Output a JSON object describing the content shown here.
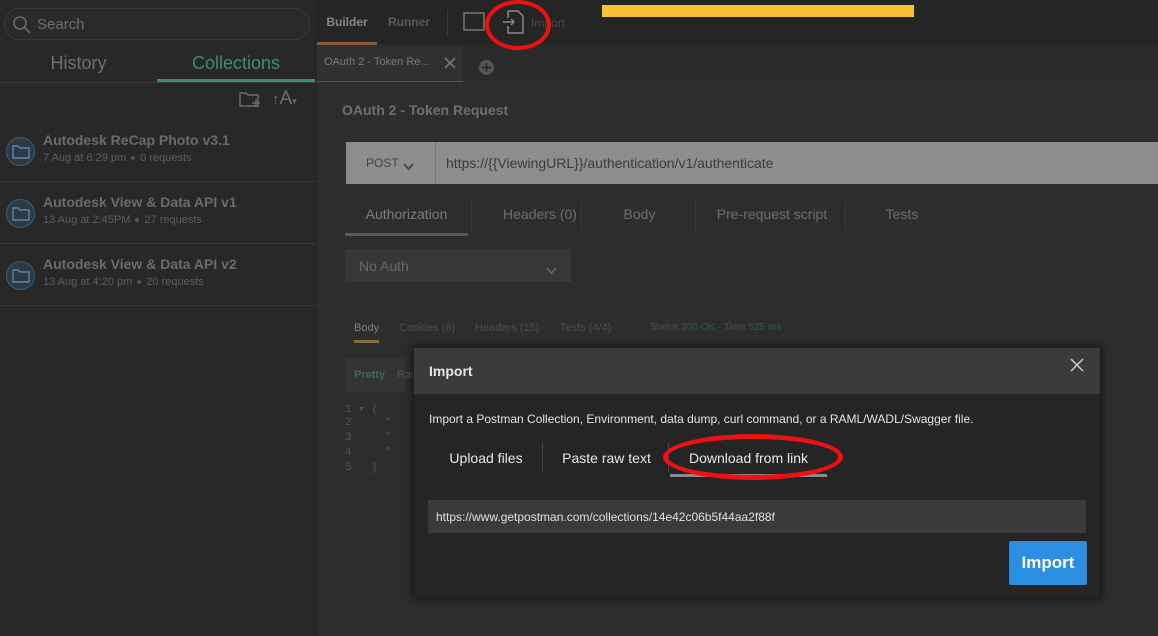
{
  "sidebar": {
    "search_placeholder": "Search",
    "tabs": {
      "history": "History",
      "collections": "Collections"
    },
    "sort_label": "A",
    "collections": [
      {
        "name": "Autodesk ReCap Photo v3.1",
        "date": "7 Aug at 6:29 pm",
        "requests": "0 requests"
      },
      {
        "name": "Autodesk View & Data API v1",
        "date": "13 Aug at 2:45PM",
        "requests": "27 requests"
      },
      {
        "name": "Autodesk View & Data API v2",
        "date": "13 Aug at 4:20 pm",
        "requests": "20 requests"
      }
    ]
  },
  "topbar": {
    "builder_label": "Builder",
    "runner_label": "Runner",
    "import_label": "Import"
  },
  "request_tab": {
    "label": "OAuth 2 - Token Re..."
  },
  "request": {
    "title": "OAuth 2 - Token Request",
    "method": "POST",
    "url": "https://{{ViewingURL}}/authentication/v1/authenticate",
    "tabs": [
      "Authorization",
      "Headers (0)",
      "Body",
      "Pre-request script",
      "Tests"
    ],
    "auth_type": "No Auth"
  },
  "response": {
    "tabs": [
      "Body",
      "Cookies (6)",
      "Headers (15)",
      "Tests (4/4)"
    ],
    "status_label": "Status",
    "status_value": "200 OK",
    "time_label": "Time",
    "time_value": "525 ms",
    "format_pretty": "Pretty",
    "format_raw": "Raw",
    "code_lines": [
      "1 ▾ {",
      "2     \"",
      "3     \"",
      "4     \"",
      "5   }"
    ]
  },
  "modal": {
    "title": "Import",
    "description": "Import a Postman Collection, Environment, data dump, curl command, or a RAML/WADL/Swagger file.",
    "tabs": {
      "upload": "Upload files",
      "paste": "Paste raw text",
      "link": "Download from link"
    },
    "link_value": "https://www.getpostman.com/collections/14e42c06b5f44aa2f88f",
    "import_button": "Import"
  },
  "colors": {
    "accent_green": "#3d8c78",
    "annotation_red": "#ee1111",
    "highlight_yellow": "#f7c233",
    "button_blue": "#2c8ee0"
  }
}
